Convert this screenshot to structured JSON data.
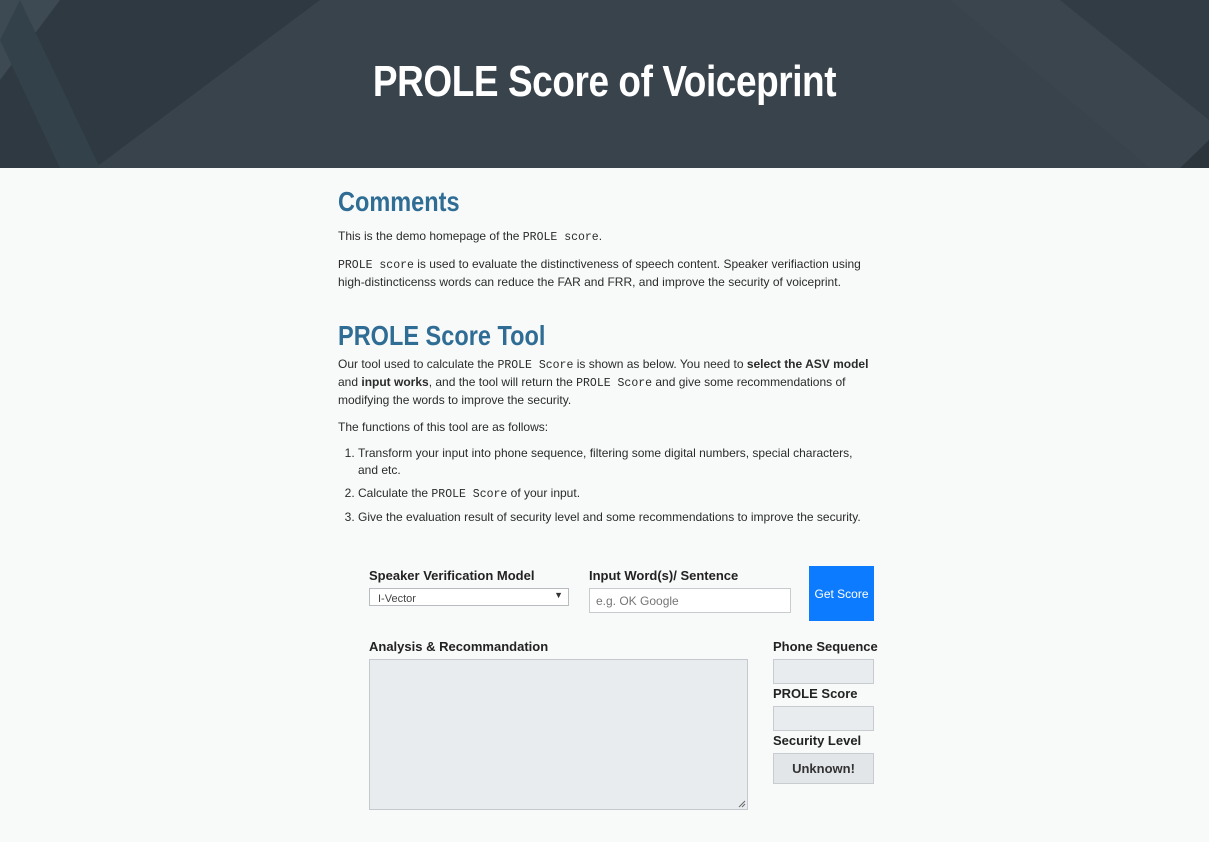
{
  "header": {
    "title": "PROLE Score of Voiceprint"
  },
  "comments": {
    "heading": "Comments",
    "p1_before": "This is the demo homepage of the ",
    "p1_code": "PROLE score",
    "p1_after": ".",
    "p2_code": "PROLE score",
    "p2_text": " is used to evaluate the distinctiveness of speech content. Speaker verifiaction using high-distincticenss words can reduce the FAR and FRR, and improve the security of voiceprint."
  },
  "tool": {
    "heading": "PROLE Score Tool",
    "p3": {
      "t1": "Our tool used to calculate the ",
      "c1": "PROLE Score",
      "t2": " is shown as below. You need to ",
      "b1": "select the ASV model",
      "t3": " and ",
      "b2": "input works",
      "t4": ", and the tool will return the ",
      "c2": "PROLE Score",
      "t5": " and give some recommendations of modifying the words to improve the security."
    },
    "p4": "The functions of this tool are as follows:",
    "list": {
      "item1": "Transform your input into phone sequence, filtering some digital numbers, special characters, and etc.",
      "item2_before": "Calculate the ",
      "item2_code": "PROLE Score",
      "item2_after": " of your input.",
      "item3": "Give the evaluation result of security level and some recommendations to improve the security."
    }
  },
  "form": {
    "model_label": "Speaker Verification Model",
    "model_value": "I-Vector",
    "input_label": "Input Word(s)/ Sentence",
    "input_placeholder": "e.g. OK Google",
    "submit_label": "Get Score",
    "analysis_label": "Analysis & Recommandation",
    "phone_label": "Phone Sequence",
    "score_label": "PROLE Score",
    "security_label": "Security Level",
    "security_value": "Unknown!"
  }
}
